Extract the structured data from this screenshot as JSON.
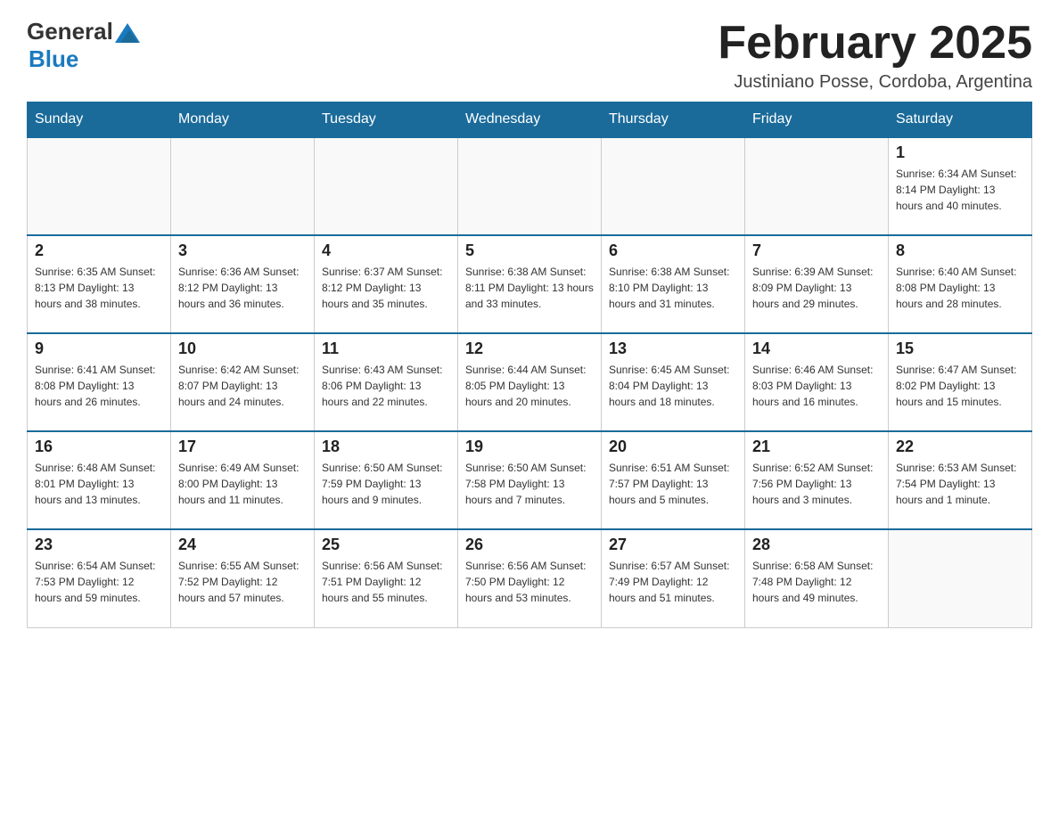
{
  "header": {
    "logo_general": "General",
    "logo_blue": "Blue",
    "title": "February 2025",
    "subtitle": "Justiniano Posse, Cordoba, Argentina"
  },
  "calendar": {
    "days_of_week": [
      "Sunday",
      "Monday",
      "Tuesday",
      "Wednesday",
      "Thursday",
      "Friday",
      "Saturday"
    ],
    "weeks": [
      [
        {
          "day": "",
          "info": ""
        },
        {
          "day": "",
          "info": ""
        },
        {
          "day": "",
          "info": ""
        },
        {
          "day": "",
          "info": ""
        },
        {
          "day": "",
          "info": ""
        },
        {
          "day": "",
          "info": ""
        },
        {
          "day": "1",
          "info": "Sunrise: 6:34 AM\nSunset: 8:14 PM\nDaylight: 13 hours and 40 minutes."
        }
      ],
      [
        {
          "day": "2",
          "info": "Sunrise: 6:35 AM\nSunset: 8:13 PM\nDaylight: 13 hours and 38 minutes."
        },
        {
          "day": "3",
          "info": "Sunrise: 6:36 AM\nSunset: 8:12 PM\nDaylight: 13 hours and 36 minutes."
        },
        {
          "day": "4",
          "info": "Sunrise: 6:37 AM\nSunset: 8:12 PM\nDaylight: 13 hours and 35 minutes."
        },
        {
          "day": "5",
          "info": "Sunrise: 6:38 AM\nSunset: 8:11 PM\nDaylight: 13 hours and 33 minutes."
        },
        {
          "day": "6",
          "info": "Sunrise: 6:38 AM\nSunset: 8:10 PM\nDaylight: 13 hours and 31 minutes."
        },
        {
          "day": "7",
          "info": "Sunrise: 6:39 AM\nSunset: 8:09 PM\nDaylight: 13 hours and 29 minutes."
        },
        {
          "day": "8",
          "info": "Sunrise: 6:40 AM\nSunset: 8:08 PM\nDaylight: 13 hours and 28 minutes."
        }
      ],
      [
        {
          "day": "9",
          "info": "Sunrise: 6:41 AM\nSunset: 8:08 PM\nDaylight: 13 hours and 26 minutes."
        },
        {
          "day": "10",
          "info": "Sunrise: 6:42 AM\nSunset: 8:07 PM\nDaylight: 13 hours and 24 minutes."
        },
        {
          "day": "11",
          "info": "Sunrise: 6:43 AM\nSunset: 8:06 PM\nDaylight: 13 hours and 22 minutes."
        },
        {
          "day": "12",
          "info": "Sunrise: 6:44 AM\nSunset: 8:05 PM\nDaylight: 13 hours and 20 minutes."
        },
        {
          "day": "13",
          "info": "Sunrise: 6:45 AM\nSunset: 8:04 PM\nDaylight: 13 hours and 18 minutes."
        },
        {
          "day": "14",
          "info": "Sunrise: 6:46 AM\nSunset: 8:03 PM\nDaylight: 13 hours and 16 minutes."
        },
        {
          "day": "15",
          "info": "Sunrise: 6:47 AM\nSunset: 8:02 PM\nDaylight: 13 hours and 15 minutes."
        }
      ],
      [
        {
          "day": "16",
          "info": "Sunrise: 6:48 AM\nSunset: 8:01 PM\nDaylight: 13 hours and 13 minutes."
        },
        {
          "day": "17",
          "info": "Sunrise: 6:49 AM\nSunset: 8:00 PM\nDaylight: 13 hours and 11 minutes."
        },
        {
          "day": "18",
          "info": "Sunrise: 6:50 AM\nSunset: 7:59 PM\nDaylight: 13 hours and 9 minutes."
        },
        {
          "day": "19",
          "info": "Sunrise: 6:50 AM\nSunset: 7:58 PM\nDaylight: 13 hours and 7 minutes."
        },
        {
          "day": "20",
          "info": "Sunrise: 6:51 AM\nSunset: 7:57 PM\nDaylight: 13 hours and 5 minutes."
        },
        {
          "day": "21",
          "info": "Sunrise: 6:52 AM\nSunset: 7:56 PM\nDaylight: 13 hours and 3 minutes."
        },
        {
          "day": "22",
          "info": "Sunrise: 6:53 AM\nSunset: 7:54 PM\nDaylight: 13 hours and 1 minute."
        }
      ],
      [
        {
          "day": "23",
          "info": "Sunrise: 6:54 AM\nSunset: 7:53 PM\nDaylight: 12 hours and 59 minutes."
        },
        {
          "day": "24",
          "info": "Sunrise: 6:55 AM\nSunset: 7:52 PM\nDaylight: 12 hours and 57 minutes."
        },
        {
          "day": "25",
          "info": "Sunrise: 6:56 AM\nSunset: 7:51 PM\nDaylight: 12 hours and 55 minutes."
        },
        {
          "day": "26",
          "info": "Sunrise: 6:56 AM\nSunset: 7:50 PM\nDaylight: 12 hours and 53 minutes."
        },
        {
          "day": "27",
          "info": "Sunrise: 6:57 AM\nSunset: 7:49 PM\nDaylight: 12 hours and 51 minutes."
        },
        {
          "day": "28",
          "info": "Sunrise: 6:58 AM\nSunset: 7:48 PM\nDaylight: 12 hours and 49 minutes."
        },
        {
          "day": "",
          "info": ""
        }
      ]
    ]
  }
}
